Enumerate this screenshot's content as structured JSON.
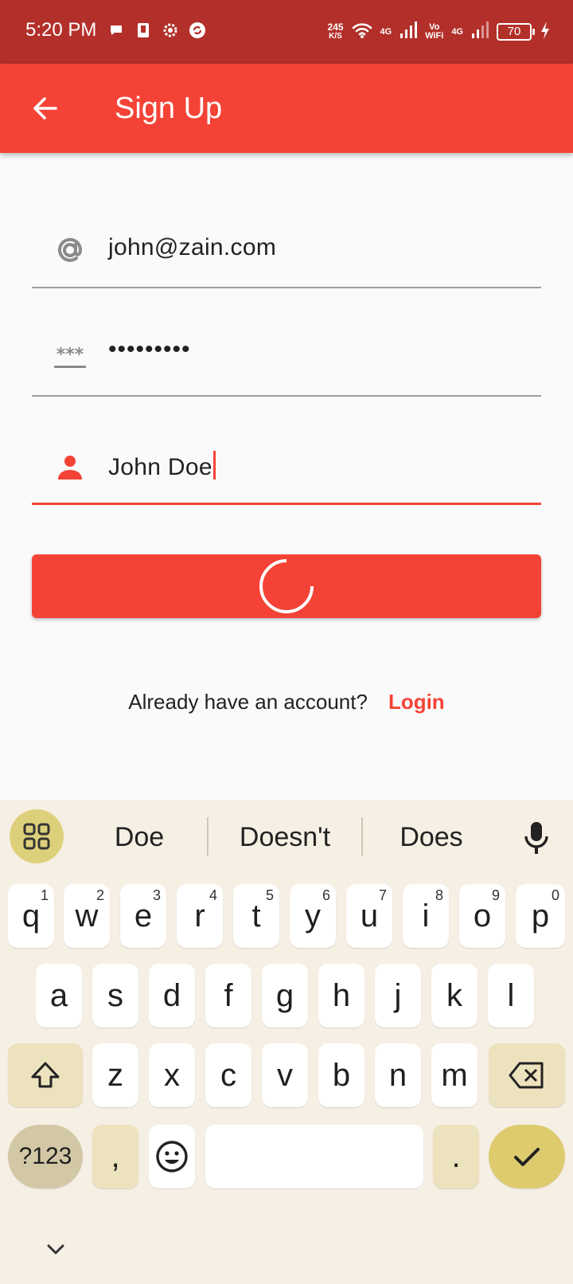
{
  "status_bar": {
    "time": "5:20 PM",
    "net_speed_value": "245",
    "net_speed_unit": "K/S",
    "net1": "4G",
    "volte_line1": "Vo",
    "volte_line2": "WiFi",
    "net2": "4G",
    "battery": "70"
  },
  "app_bar": {
    "title": "Sign Up"
  },
  "form": {
    "email_value": "john@zain.com",
    "password_value": "•••••••••",
    "name_value": "John Doe",
    "button_state": "loading"
  },
  "footer": {
    "question": "Already have an account?",
    "login_link": "Login"
  },
  "keyboard": {
    "suggestions": [
      "Doe",
      "Doesn't",
      "Does"
    ],
    "row1": [
      {
        "key": "q",
        "hint": "1"
      },
      {
        "key": "w",
        "hint": "2"
      },
      {
        "key": "e",
        "hint": "3"
      },
      {
        "key": "r",
        "hint": "4"
      },
      {
        "key": "t",
        "hint": "5"
      },
      {
        "key": "y",
        "hint": "6"
      },
      {
        "key": "u",
        "hint": "7"
      },
      {
        "key": "i",
        "hint": "8"
      },
      {
        "key": "o",
        "hint": "9"
      },
      {
        "key": "p",
        "hint": "0"
      }
    ],
    "row2": [
      "a",
      "s",
      "d",
      "f",
      "g",
      "h",
      "j",
      "k",
      "l"
    ],
    "row3": [
      "z",
      "x",
      "c",
      "v",
      "b",
      "n",
      "m"
    ],
    "symbols_label": "?123",
    "comma": ",",
    "period": "."
  },
  "colors": {
    "status_bar": "#b3302a",
    "primary": "#f44336",
    "keyboard_bg": "#f6efe4",
    "keyboard_accent": "#ddcb6e"
  }
}
